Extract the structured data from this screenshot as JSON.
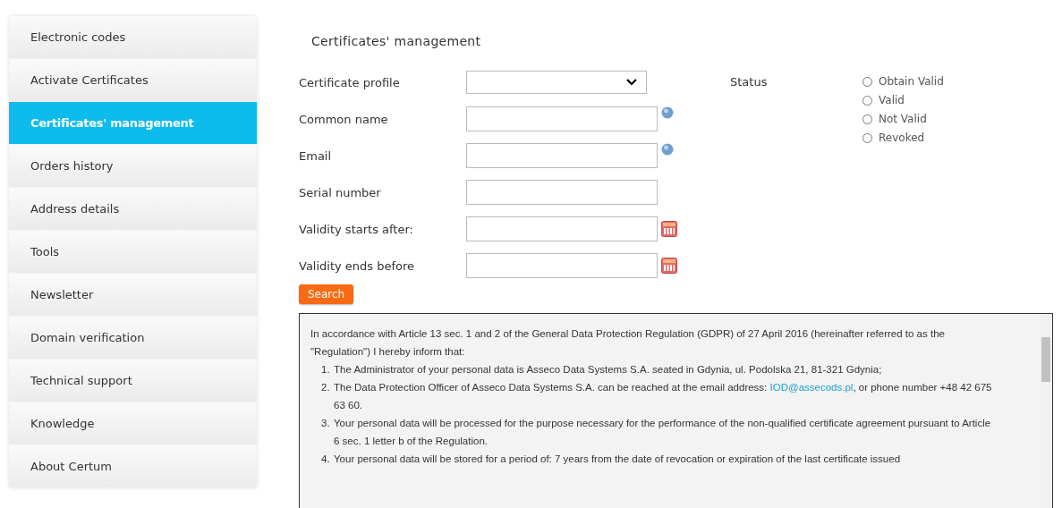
{
  "sidebar": {
    "items": [
      {
        "label": "Electronic codes",
        "selected": false
      },
      {
        "label": "Activate Certificates",
        "selected": false
      },
      {
        "label": "Certificates' management",
        "selected": true
      },
      {
        "label": "Orders history",
        "selected": false
      },
      {
        "label": "Address details",
        "selected": false
      },
      {
        "label": "Tools",
        "selected": false
      },
      {
        "label": "Newsletter",
        "selected": false
      },
      {
        "label": "Domain verification",
        "selected": false
      },
      {
        "label": "Technical support",
        "selected": false
      },
      {
        "label": "Knowledge",
        "selected": false
      },
      {
        "label": "About Certum",
        "selected": false
      }
    ]
  },
  "page_title": "Certificates' management",
  "form": {
    "fields": [
      {
        "label": "Certificate profile",
        "kind": "select"
      },
      {
        "label": "Common name",
        "kind": "help"
      },
      {
        "label": "Email",
        "kind": "help"
      },
      {
        "label": "Serial number",
        "kind": "text"
      },
      {
        "label": "Validity starts after:",
        "kind": "date"
      },
      {
        "label": "Validity ends before",
        "kind": "date"
      }
    ],
    "status": {
      "label": "Status",
      "options": [
        {
          "label": "Obtain Valid",
          "selected": false
        },
        {
          "label": "Valid",
          "selected": false
        },
        {
          "label": "Not Valid",
          "selected": false
        },
        {
          "label": "Revoked",
          "selected": false
        }
      ]
    },
    "search_button": "Search"
  },
  "notice": {
    "intro": "In accordance with Article 13 sec. 1 and 2 of the General Data Protection Regulation (GDPR) of 27 April 2016 (hereinafter referred to as the \"Regulation\") I hereby inform that:",
    "items": [
      {
        "number": "1.",
        "text": "The Administrator of your personal data is Asseco Data Systems S.A. seated in Gdynia, ul. Podolska 21, 81-321 Gdynia;"
      },
      {
        "number": "2.",
        "text": "The Data Protection Officer of Asseco Data Systems S.A. can be reached at the email address:",
        "link": "IOD@assecods.pl",
        "after": ", or phone number +48 42 675 63 60."
      },
      {
        "number": "3.",
        "text": "Your personal data will be processed for the purpose necessary for the performance of the non-qualified certificate agreement pursuant to Article 6 sec. 1 letter b of the Regulation."
      },
      {
        "number": "4.",
        "text": "Your personal data will be stored for a period of: 7 years from the date of revocation or expiration of the last certificate issued"
      }
    ]
  }
}
